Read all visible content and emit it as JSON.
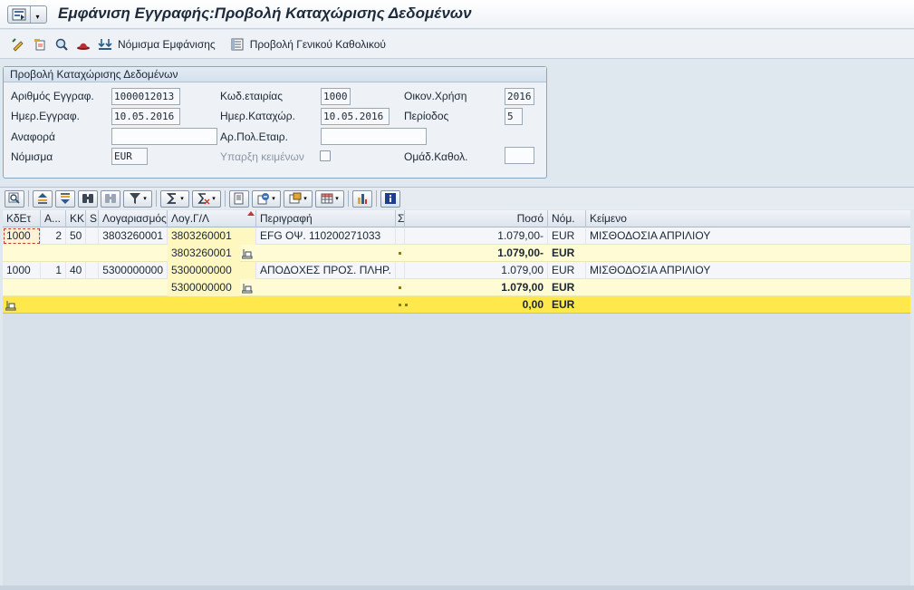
{
  "window": {
    "title": "Εμφάνιση Εγγραφής:Προβολή Καταχώρισης Δεδομένων"
  },
  "toolbar": {
    "currency_btn": "Νόμισμα Εμφάνισης",
    "general_ledger_btn": "Προβολή Γενικού Καθολικού"
  },
  "header_group": {
    "title": "Προβολή Καταχώρισης Δεδομένων",
    "doc_no_label": "Αριθμός Εγγραφ.",
    "doc_no": "1000012013",
    "company_label": "Κωδ.εταιρίας",
    "company": "1000",
    "fiscal_year_label": "Οικον.Χρήση",
    "fiscal_year": "2016",
    "doc_date_label": "Ημερ.Εγγραφ.",
    "doc_date": "10.05.2016",
    "posting_date_label": "Ημερ.Καταχώρ.",
    "posting_date": "10.05.2016",
    "period_label": "Περίοδος",
    "period": "5",
    "reference_label": "Αναφορά",
    "reference": "",
    "cross_company_label": "Αρ.Πολ.Εταιρ.",
    "cross_company": "",
    "currency_label": "Νόμισμα",
    "currency": "EUR",
    "texts_exist_label": "Υπαρξη κειμένων",
    "ledger_group_label": "Ομάδ.Καθολ.",
    "ledger_group": ""
  },
  "grid": {
    "columns": [
      "ΚδΕτ",
      "Α...",
      "ΚΚ",
      "S",
      "Λογαριασμός",
      "Λογ.Γ/Λ",
      "Περιγραφή",
      "Σ",
      "Ποσό",
      "Νόμ.",
      "Κείμενο"
    ],
    "rows": [
      {
        "company": "1000",
        "item": "2",
        "pk": "50",
        "s": "",
        "account": "3803260001",
        "gl": "3803260001",
        "desc": "EFG ΟΨ. 110200271033",
        "amount": "1.079,00-",
        "currency": "EUR",
        "text": "ΜΙΣΘΟΔΟΣΙΑ ΑΠΡΙΛΙΟΥ"
      },
      {
        "gl": "3803260001",
        "amount": "1.079,00-",
        "currency": "EUR"
      },
      {
        "company": "1000",
        "item": "1",
        "pk": "40",
        "s": "",
        "account": "5300000000",
        "gl": "5300000000",
        "desc": "ΑΠΟΔΟΧΕΣ ΠΡΟΣ. ΠΛΗΡ.",
        "amount": "1.079,00",
        "currency": "EUR",
        "text": "ΜΙΣΘΟΔΟΣΙΑ ΑΠΡΙΛΙΟΥ"
      },
      {
        "gl": "5300000000",
        "amount": "1.079,00",
        "currency": "EUR"
      },
      {
        "amount": "0,00",
        "currency": "EUR"
      }
    ]
  }
}
